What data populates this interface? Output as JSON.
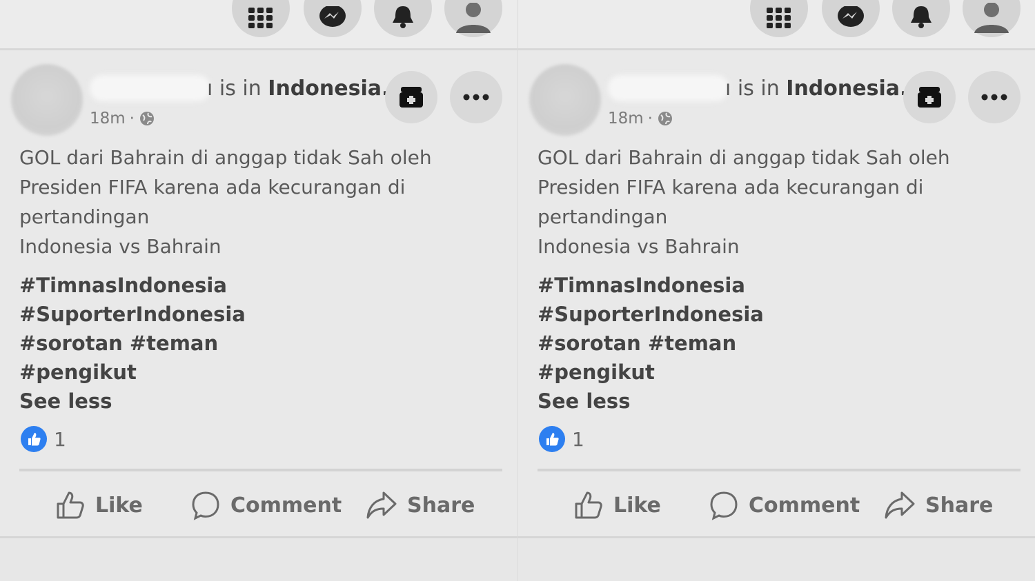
{
  "posts": [
    {
      "location_prefix": "is in",
      "location": "Indonesia.",
      "time": "18m",
      "body_lines": [
        "GOL dari Bahrain di anggap tidak Sah oleh",
        "Presiden FIFA karena ada kecurangan di",
        "pertandingan",
        "Indonesia vs Bahrain"
      ],
      "hashtag_lines": [
        "#TimnasIndonesia",
        "#SuporterIndonesia",
        "#sorotan #teman",
        "#pengikut"
      ],
      "see_less": "See less",
      "reaction_count": "1",
      "actions": {
        "like": "Like",
        "comment": "Comment",
        "share": "Share"
      }
    },
    {
      "location_prefix": "is in",
      "location": "Indonesia.",
      "time": "18m",
      "body_lines": [
        "GOL dari Bahrain di anggap tidak Sah oleh",
        "Presiden FIFA karena ada kecurangan di",
        "pertandingan",
        "Indonesia vs Bahrain"
      ],
      "hashtag_lines": [
        "#TimnasIndonesia",
        "#SuporterIndonesia",
        "#sorotan #teman",
        "#pengikut"
      ],
      "see_less": "See less",
      "reaction_count": "1",
      "actions": {
        "like": "Like",
        "comment": "Comment",
        "share": "Share"
      }
    }
  ],
  "icons": {
    "top_nav": [
      "menu-grid-icon",
      "messenger-icon",
      "bell-icon",
      "profile-icon"
    ],
    "post_header": [
      "save-icon",
      "more-icon"
    ],
    "privacy": "globe-icon"
  },
  "colors": {
    "like_blue": "#2d7ff0"
  }
}
